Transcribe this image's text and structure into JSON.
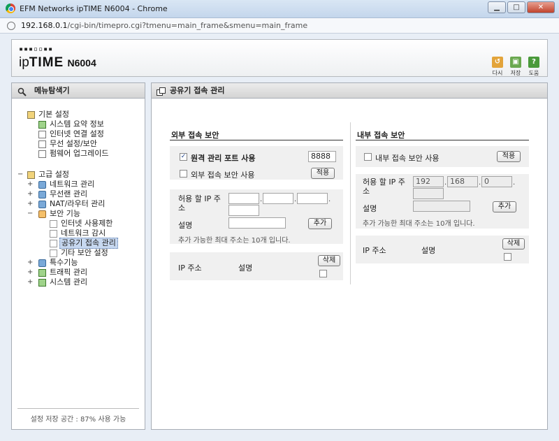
{
  "window": {
    "title": "EFM Networks ipTIME N6004 - Chrome",
    "controls": [
      "minimize",
      "maximize",
      "close"
    ]
  },
  "address": {
    "host": "192.168.0.1",
    "path": "/cgi-bin/timepro.cgi?tmenu=main_frame&smenu=main_frame"
  },
  "header": {
    "logo_dots": "▪▪▪▫▫▪▪",
    "logo_ip": "ip",
    "logo_time": "TIME",
    "logo_model": "N6004",
    "buttons": [
      {
        "label": "다시",
        "icon": "refresh-icon",
        "color": "#e3a43a"
      },
      {
        "label": "저장",
        "icon": "save-icon",
        "color": "#6aa84f"
      },
      {
        "label": "도움",
        "icon": "help-icon",
        "color": "#4a9a3a"
      }
    ]
  },
  "sidebar": {
    "title": "메뉴탐색기",
    "groups": [
      {
        "label": "기본 설정",
        "items": [
          "시스템 요약 정보",
          "인터넷 연결 설정",
          "무선 설정/보안",
          "펌웨어 업그레이드"
        ]
      },
      {
        "label": "고급 설정",
        "items": [
          "네트워크 관리",
          "무선랜 관리",
          "NAT/라우터 관리",
          "보안 기능"
        ],
        "subitems": [
          "인터넷 사용제한",
          "네트워크 감시",
          "공유기 접속 관리",
          "기타 보안 설정"
        ],
        "items_after": [
          "특수기능",
          "트래픽 관리",
          "시스템 관리"
        ]
      }
    ],
    "selected": "공유기 접속 관리",
    "footer": "설정 저장 공간 : 87% 사용 가능"
  },
  "main": {
    "title": "공유기 접속 관리",
    "external": {
      "section_title": "외부 접속 보안",
      "remote_port_label": "원격 관리 포트 사용",
      "remote_port_checked": true,
      "remote_port_value": "8888",
      "ext_security_label": "외부 접속 보안 사용",
      "ext_security_checked": false,
      "apply": "적용",
      "allow_ip_label": "허용 할 IP 주소",
      "desc_label": "설명",
      "add": "추가",
      "max_note": "추가 가능한 최대 주소는 10개 입니다.",
      "col_ip": "IP 주소",
      "col_desc": "설명",
      "delete": "삭제"
    },
    "internal": {
      "section_title": "내부 접속 보안",
      "int_security_label": "내부 접속 보안 사용",
      "int_security_checked": false,
      "apply": "적용",
      "allow_ip_label": "허용 할 IP 주소",
      "ip1": "192",
      "ip2": "168",
      "ip3": "0",
      "desc_label": "설명",
      "add": "추가",
      "max_note": "추가 가능한 최대 주소는 10개 입니다.",
      "col_ip": "IP 주소",
      "col_desc": "설명",
      "delete": "삭제"
    }
  }
}
